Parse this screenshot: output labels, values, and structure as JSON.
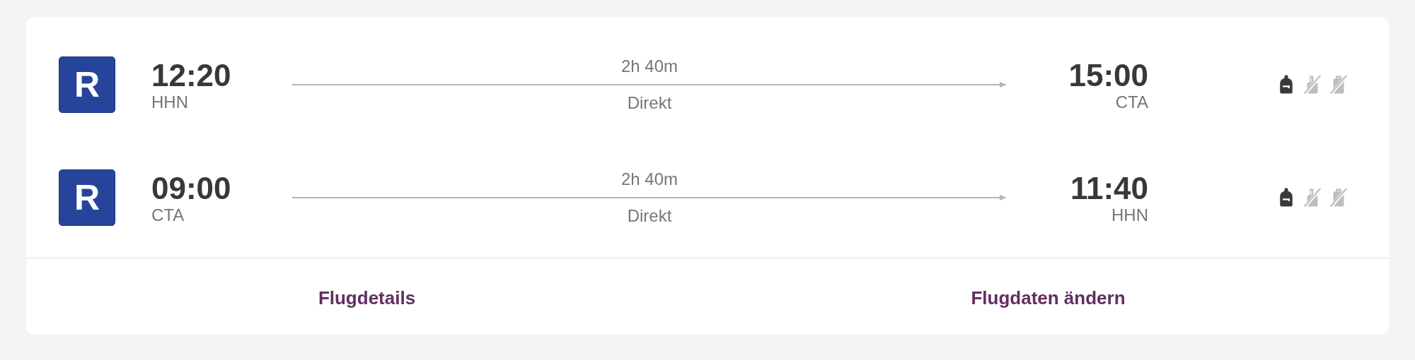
{
  "flights": [
    {
      "airline_logo": "R",
      "departure_time": "12:20",
      "departure_airport": "HHN",
      "duration": "2h 40m",
      "stops": "Direkt",
      "arrival_time": "15:00",
      "arrival_airport": "CTA",
      "baggage": [
        {
          "kind": "backpack",
          "included": true
        },
        {
          "kind": "trolley",
          "included": false
        },
        {
          "kind": "suitcase",
          "included": false
        }
      ]
    },
    {
      "airline_logo": "R",
      "departure_time": "09:00",
      "departure_airport": "CTA",
      "duration": "2h 40m",
      "stops": "Direkt",
      "arrival_time": "11:40",
      "arrival_airport": "HHN",
      "baggage": [
        {
          "kind": "backpack",
          "included": true
        },
        {
          "kind": "trolley",
          "included": false
        },
        {
          "kind": "suitcase",
          "included": false
        }
      ]
    }
  ],
  "actions": [
    "Flugdetails",
    "Flugdaten ändern"
  ]
}
